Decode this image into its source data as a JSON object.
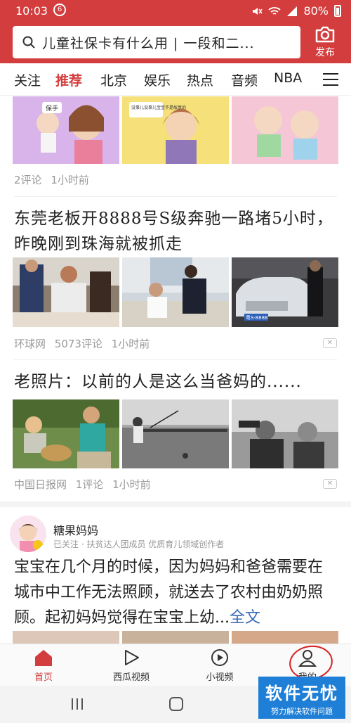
{
  "status_bar": {
    "time": "10:03",
    "battery": "80%"
  },
  "search": {
    "query": "儿童社保卡有什么用 | 一段和二..."
  },
  "publish": {
    "label": "发布"
  },
  "tabs": [
    {
      "label": "关注"
    },
    {
      "label": "推荐",
      "active": true
    },
    {
      "label": "北京"
    },
    {
      "label": "娱乐"
    },
    {
      "label": "热点"
    },
    {
      "label": "音频"
    },
    {
      "label": "NBA"
    }
  ],
  "articles": [
    {
      "meta": [
        "2评论",
        "1小时前"
      ]
    },
    {
      "title": "东莞老板开8888号S级奔驰一路堵5小时，昨晚刚到珠海就被抓走",
      "meta": [
        "环球网",
        "5073评论",
        "1小时前"
      ]
    },
    {
      "title": "老照片：以前的人是这么当爸妈的......",
      "meta": [
        "中国日报网",
        "1评论",
        "1小时前"
      ]
    }
  ],
  "post": {
    "author": "糖果妈妈",
    "desc": "已关注 · 扶贫达人团成员  优质育儿领域创作者",
    "text": "宝宝在几个月的时候，因为妈妈和爸爸需要在城市中工作无法照顾，就送去了农村由奶奶照顾。起初妈妈觉得在宝宝上幼...",
    "more": "全文"
  },
  "comic_text": {
    "bubble1": "保手",
    "bubble2": "没事儿没事儿宝宝不是故意的"
  },
  "plate_text": "粤S·8888",
  "bottom_nav": [
    {
      "label": "首页",
      "active": true
    },
    {
      "label": "西瓜视频"
    },
    {
      "label": "小视频"
    },
    {
      "label": "我的"
    }
  ],
  "watermark": {
    "title": "软件无忧",
    "subtitle": "努力解决软件问题"
  },
  "colors": {
    "brand": "#d43d3d",
    "link": "#3a6ab8",
    "watermark": "#1f7fd6"
  }
}
